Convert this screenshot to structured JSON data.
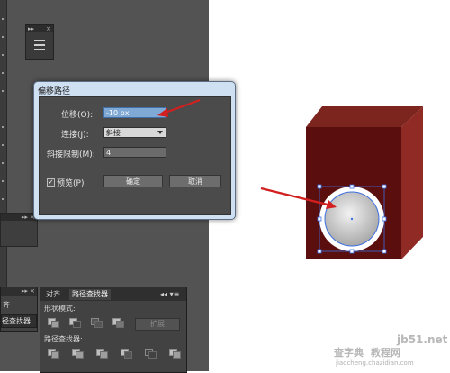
{
  "dialog": {
    "title": "偏移路径",
    "offset_label": "位移(O):",
    "offset_value": "-10 px",
    "join_label": "连接(J):",
    "join_value": "斜接",
    "miter_label": "斜接限制(M):",
    "miter_value": "4",
    "preview_check": "✓",
    "preview_label": "预览(P)",
    "ok_label": "确定",
    "cancel_label": "取消"
  },
  "left_panel": {
    "align_label": "齐",
    "pathfinder_label": "径查找器"
  },
  "pathfinder_panel": {
    "tabs": [
      "对齐",
      "路径查找器"
    ],
    "tab_controls": "◂◂ ▾≡",
    "shape_modes_label": "形状模式:",
    "expand_label": "扩展",
    "pathfinders_label": "路径查找器:"
  },
  "panel_header": {
    "collapse": "▸▸",
    "close": "×"
  },
  "watermark": {
    "text_1": "查字典",
    "text_2": "教程网",
    "site": "jb51.net",
    "url": "jiaocheng.chazidian.com"
  },
  "colors": {
    "box_front": "#5a0e0d",
    "box_top": "#8a2a22",
    "box_side": "#8f2b24",
    "arrow": "#d21f1f",
    "selection": "#3d6fe0"
  }
}
